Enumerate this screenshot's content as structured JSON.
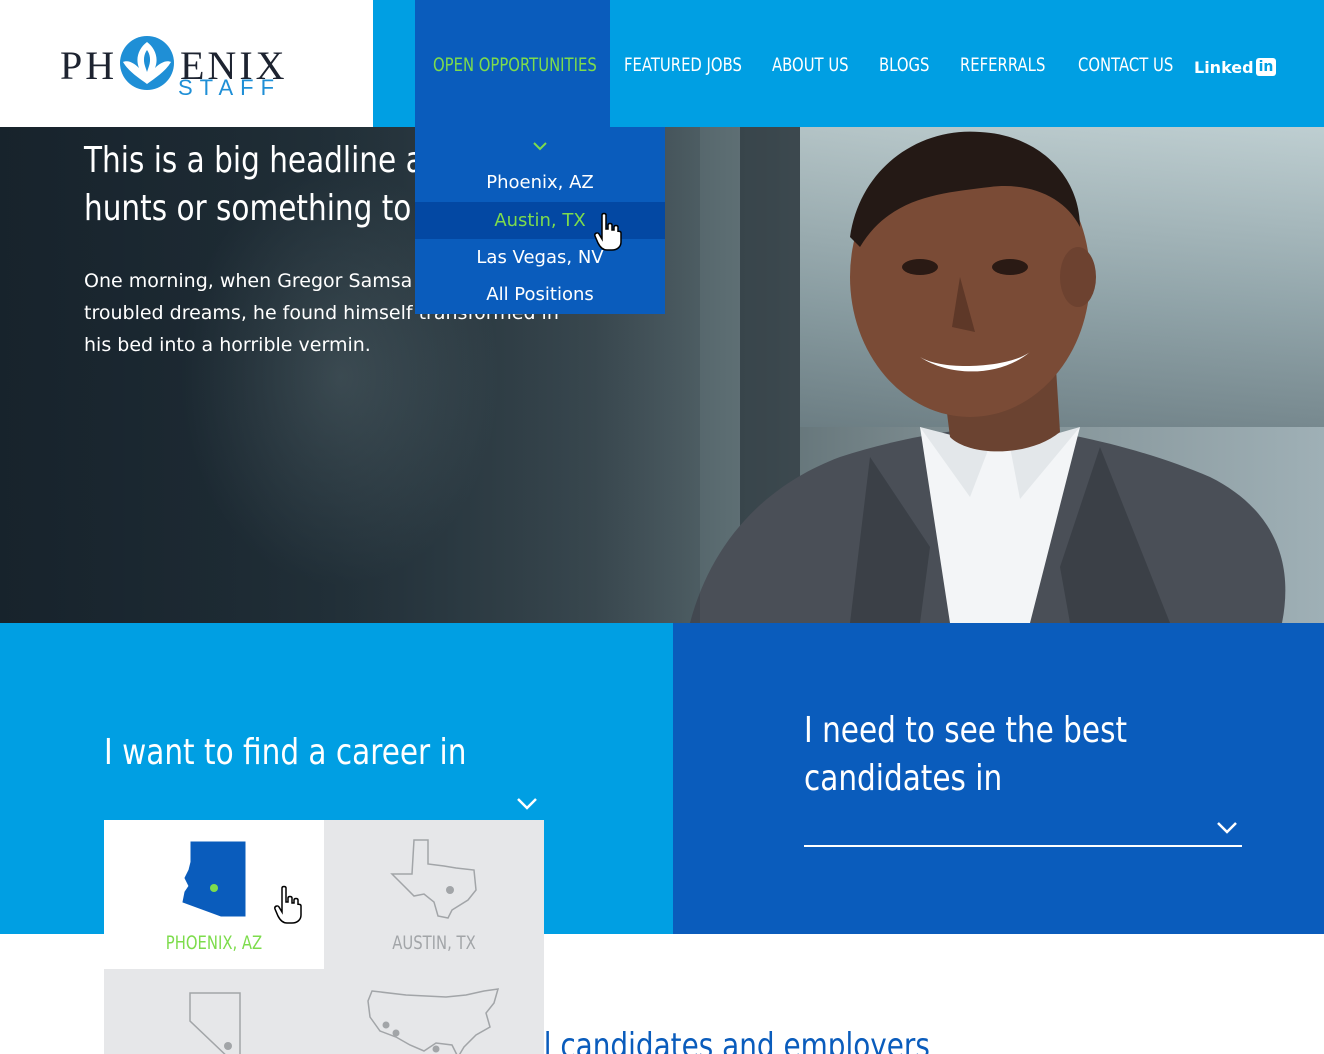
{
  "brand": {
    "logo_text_left": "PH",
    "logo_text_right": "ENIX",
    "logo_subtext": "STAFF",
    "primary_color": "#009fe3",
    "dark_blue": "#0a5cbc",
    "accent_green": "#7ddc4c"
  },
  "nav": {
    "items": [
      {
        "label": "OPEN OPPORTUNITIES",
        "active": true
      },
      {
        "label": "FEATURED JOBS"
      },
      {
        "label": "ABOUT US"
      },
      {
        "label": "BLOGS"
      },
      {
        "label": "REFERRALS"
      },
      {
        "label": "CONTACT US"
      }
    ],
    "linkedin_label": "Linked",
    "linkedin_box": "in"
  },
  "dropdown": {
    "items": [
      "Phoenix, AZ",
      "Austin, TX",
      "Las Vegas, NV",
      "All Positions"
    ],
    "hovered": "Austin, TX"
  },
  "hero": {
    "headline_line1": "This is a big headline abo",
    "headline_line2": "hunts or something to that effect",
    "body": "One morning, when Gregor Samsa woke from troubled dreams, he found himself transformed in his bed into a horrible vermin."
  },
  "career": {
    "left_heading": "I want to find a career in",
    "right_heading_line1": "I need to see the best",
    "right_heading_line2": "candidates in",
    "states": [
      {
        "label": "PHOENIX, AZ",
        "selected": true,
        "icon": "arizona-icon"
      },
      {
        "label": "AUSTIN, TX",
        "selected": false,
        "icon": "texas-icon"
      },
      {
        "label": "",
        "selected": false,
        "icon": "nevada-icon"
      },
      {
        "label": "",
        "selected": false,
        "icon": "usa-icon"
      }
    ]
  },
  "bottom": {
    "partial_text": "ll candidates and employers"
  }
}
